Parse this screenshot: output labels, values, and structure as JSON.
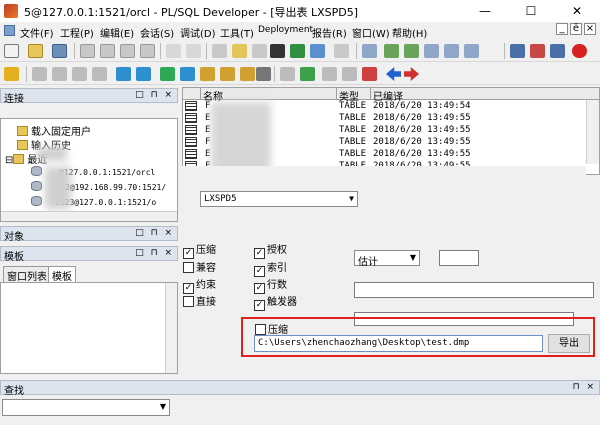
{
  "window": {
    "title": "5@127.0.0.1:1521/orcl - PL/SQL Developer - [导出表 LXSPD5]",
    "min": "—",
    "max": "☐",
    "close": "✕"
  },
  "menu": [
    {
      "label": "文件(F)"
    },
    {
      "label": "工程(P)"
    },
    {
      "label": "编辑(E)"
    },
    {
      "label": "会话(S)"
    },
    {
      "label": "调试(D)"
    },
    {
      "label": "工具(T)"
    },
    {
      "label": "Deployment"
    },
    {
      "label": "报告(R)"
    },
    {
      "label": "窗口(W)"
    },
    {
      "label": "帮助(H)"
    }
  ],
  "mdi": {
    "min": "_",
    "restore": "ē",
    "close": "×"
  },
  "panels": {
    "connection": {
      "title": "连接",
      "btns": "□ ⊓ ×"
    },
    "objects": {
      "title": "对象",
      "btns": "□ ⊓ ×"
    },
    "templates": {
      "title": "模板",
      "btns": "□ ⊓ ×",
      "tabs": [
        "窗口列表",
        "模板"
      ]
    },
    "search": {
      "title": "查找",
      "btns": "⊓ ×"
    }
  },
  "tree": [
    {
      "label": "载入固定用户",
      "type": "folder"
    },
    {
      "label": "输入历史",
      "type": "folder"
    },
    {
      "label": "最近",
      "type": "folder",
      "expander": "⊟"
    },
    {
      "label": "@127.0.0.1:1521/orcl",
      "type": "db"
    },
    {
      "label": "2@192.168.99.70:1521/",
      "type": "db"
    },
    {
      "label": "1023@127.0.0.1:1521/o",
      "type": "db"
    }
  ],
  "table": {
    "headers": [
      "名称",
      "类型",
      "已编译"
    ],
    "rows": [
      {
        "name": "F",
        "type": "TABLE",
        "compiled": "2018/6/20 13:49:54"
      },
      {
        "name": "E",
        "type": "TABLE",
        "compiled": "2018/6/20 13:49:55"
      },
      {
        "name": "E",
        "type": "TABLE",
        "compiled": "2018/6/20 13:49:55"
      },
      {
        "name": "F",
        "type": "TABLE",
        "compiled": "2018/6/20 13:49:55"
      },
      {
        "name": "E",
        "type": "TABLE",
        "compiled": "2018/6/20 13:49:55"
      },
      {
        "name": "F",
        "type": "TABLE",
        "compiled": "2018/6/20 13:49:55"
      }
    ]
  },
  "export": {
    "user_select": "LXSPD5",
    "options": [
      {
        "label": "压缩",
        "checked": true
      },
      {
        "label": "兼容",
        "checked": false
      },
      {
        "label": "约束",
        "checked": true
      },
      {
        "label": "直接",
        "checked": false
      },
      {
        "label": "授权",
        "checked": true
      },
      {
        "label": "索引",
        "checked": true
      },
      {
        "label": "行数",
        "checked": true
      },
      {
        "label": "触发器",
        "checked": true
      }
    ],
    "estimate": "估计",
    "compress": {
      "label": "压缩",
      "checked": false
    },
    "path": "C:\\Users\\zhenchaozhang\\Desktop\\test.dmp",
    "export_label": "导出"
  },
  "colors": {
    "accent": "#e02020",
    "panel_head": "#dde4ee"
  },
  "icons": [
    "new-icon",
    "open-icon",
    "save-icon",
    "print-icon",
    "undo-icon",
    "redo-icon",
    "cut-icon",
    "copy-icon",
    "paste-icon",
    "find-icon",
    "execute-icon",
    "stop-icon",
    "commit-icon",
    "rollback-icon",
    "key-icon",
    "arrow-left-icon",
    "arrow-right-icon"
  ]
}
